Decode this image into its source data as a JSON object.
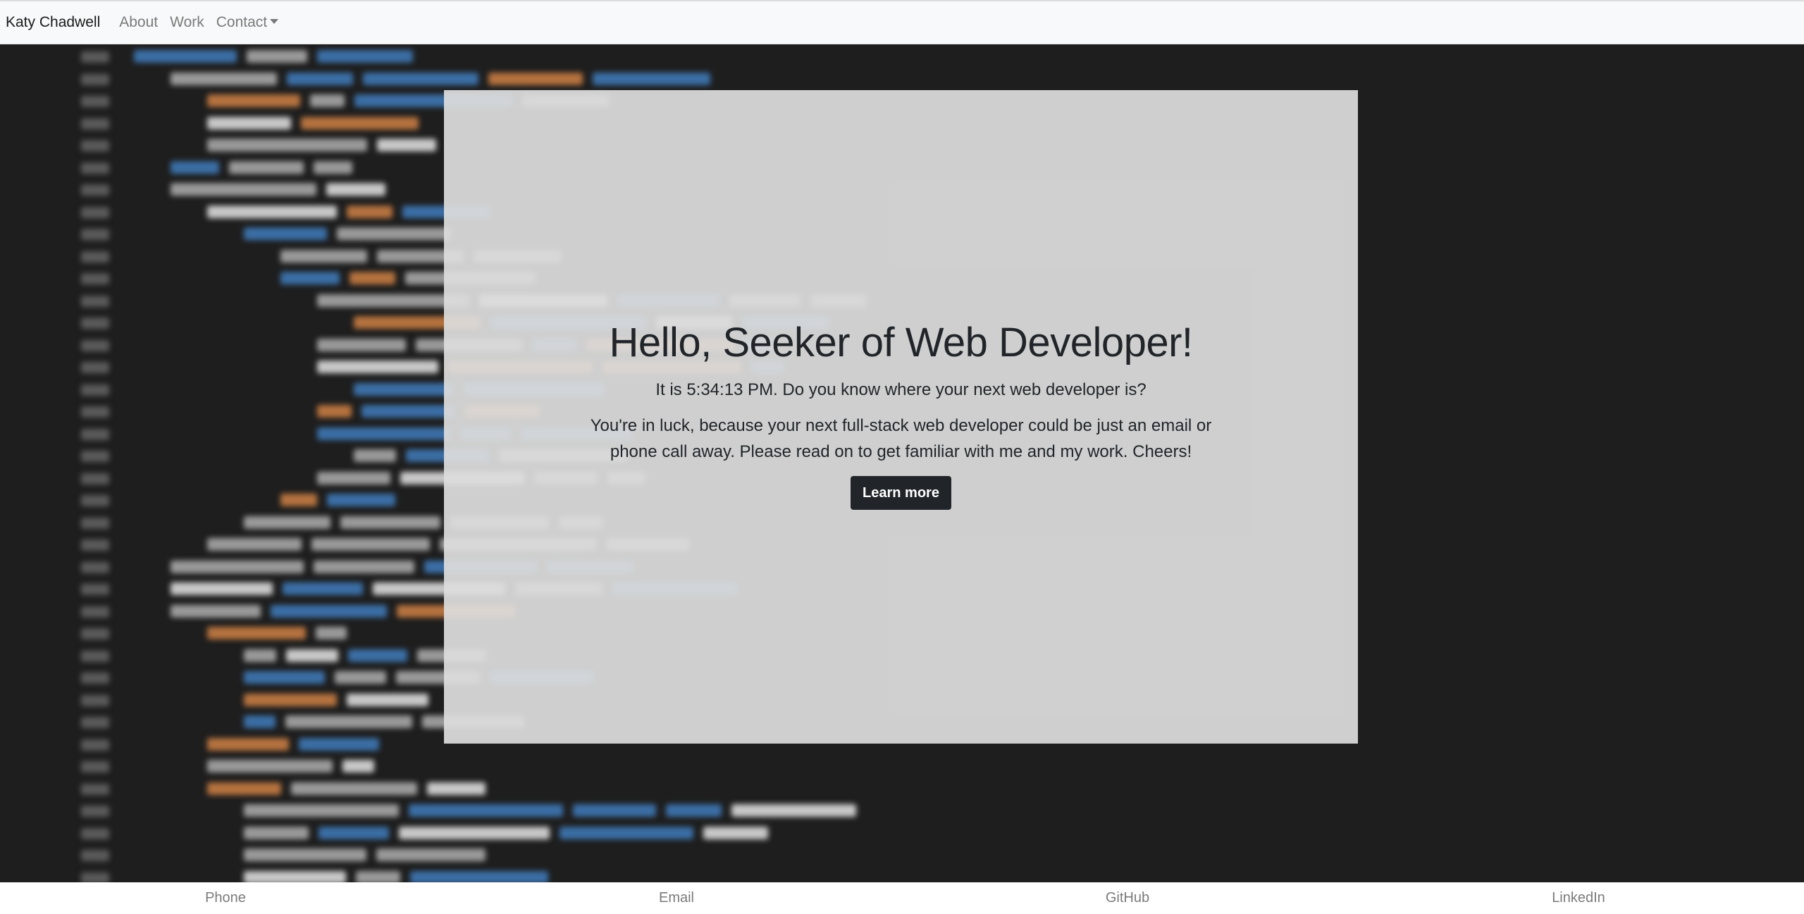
{
  "navbar": {
    "brand": "Katy Chadwell",
    "links": [
      "About",
      "Work"
    ],
    "dropdown_label": "Contact"
  },
  "hero": {
    "title": "Hello, Seeker of Web Developer!",
    "time_text": "It is 5:34:13 PM. Do you know where your next web developer is?",
    "lead": "You're in luck, because your next full-stack web developer could be just an email or phone call away. Please read on to get familiar with me and my work. Cheers!",
    "button_label": "Learn more"
  },
  "footer": {
    "links": [
      "Phone",
      "Email",
      "GitHub",
      "LinkedIn"
    ]
  },
  "colors": {
    "navbar_bg": "#f8f9fa",
    "page_bg": "#1e1e1e",
    "hero_bg": "#dddddd",
    "button_bg": "#212529",
    "muted_text": "#7a7a7a"
  }
}
